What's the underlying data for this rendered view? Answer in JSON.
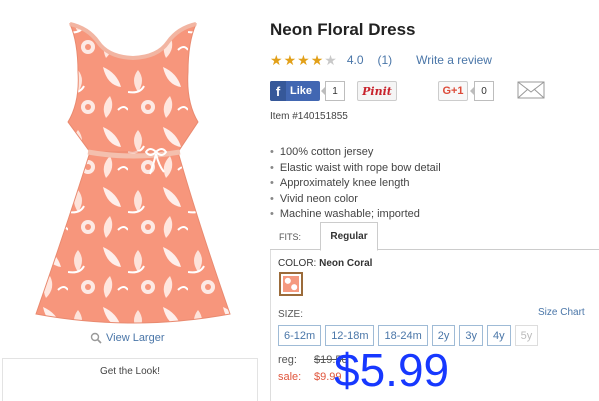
{
  "product": {
    "title": "Neon Floral Dress",
    "rating_value": "4.0",
    "rating_count": "(1)",
    "rating_stars": 4,
    "write_review": "Write a review",
    "item_number": "Item #140151855",
    "view_larger": "View Larger",
    "get_the_look": "Get the Look!",
    "features": [
      "100% cotton jersey",
      "Elastic waist with rope bow detail",
      "Approximately knee length",
      "Vivid neon color",
      "Machine washable; imported"
    ]
  },
  "social": {
    "fb_label": "Like",
    "fb_count": "1",
    "pin_label": "Pinit",
    "gplus_label": "G+1",
    "gplus_count": "0"
  },
  "fits": {
    "label": "FITS:",
    "active_tab": "Regular"
  },
  "color": {
    "label": "COLOR:",
    "value": "Neon Coral",
    "swatch_color": "#f59a80"
  },
  "size": {
    "label": "SIZE:",
    "chart_link": "Size Chart",
    "options": [
      "6-12m",
      "12-18m",
      "18-24m",
      "2y",
      "3y",
      "4y",
      "5y"
    ]
  },
  "price": {
    "reg_label": "reg:",
    "reg_value": "$19.50",
    "sale_label": "sale:",
    "sale_value": "$9.99",
    "overlay_price": "$5.99"
  },
  "colors": {
    "link": "#4a76a8",
    "sale": "#e0553c",
    "star": "#e2a019",
    "overlay": "#1738ff",
    "dress": "#f7967c"
  }
}
